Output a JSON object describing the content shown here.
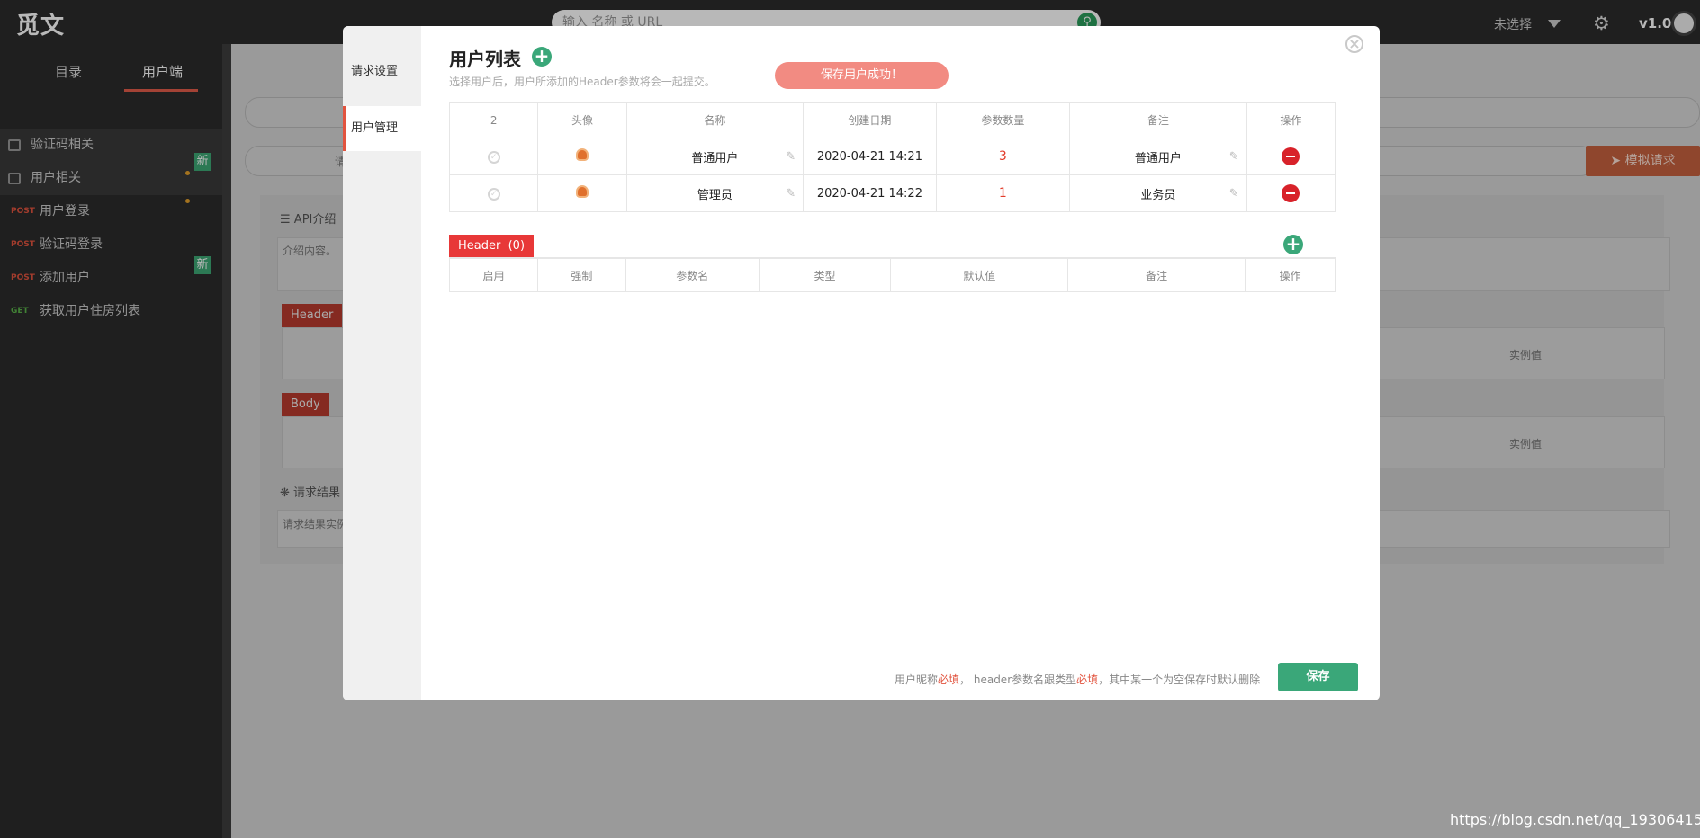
{
  "app": {
    "logo": "觅文",
    "search_placeholder": "输入 名称 或 URL",
    "env_select": "未选择",
    "version": "v1.0"
  },
  "sidebar": {
    "tabs": [
      {
        "label": "目录"
      },
      {
        "label": "用户端"
      }
    ],
    "groups": [
      {
        "label": "验证码相关"
      },
      {
        "label": "用户相关",
        "badge": "新"
      }
    ],
    "apis": [
      {
        "method": "POST",
        "label": "用户登录"
      },
      {
        "method": "POST",
        "label": "验证码登录"
      },
      {
        "method": "POST",
        "label": "添加用户",
        "badge": "新"
      },
      {
        "method": "GET",
        "label": "获取用户住房列表"
      }
    ]
  },
  "background": {
    "send_button": "模拟请求",
    "api_intro": "API介绍",
    "intro_placeholder": "介绍内容。",
    "header_tag": "Header",
    "body_tag": "Body",
    "example_value": "实例值",
    "result_label": "请求结果",
    "result_placeholder": "请求结果实例",
    "url_prefix": "请"
  },
  "modal": {
    "nav": [
      {
        "label": "请求设置"
      },
      {
        "label": "用户管理"
      }
    ],
    "title": "用户列表",
    "subtitle": "选择用户后，用户所添加的Header参数将会一起提交。",
    "toast": "保存用户成功！",
    "users_table": {
      "count": "2",
      "columns": [
        "头像",
        "名称",
        "创建日期",
        "参数数量",
        "备注",
        "操作"
      ],
      "rows": [
        {
          "name": "普通用户",
          "created": "2020-04-21 14:21",
          "param_count": "3",
          "note": "普通用户"
        },
        {
          "name": "管理员",
          "created": "2020-04-21 14:22",
          "param_count": "1",
          "note": "业务员"
        }
      ]
    },
    "header_section": {
      "label": "Header",
      "count": "(0)",
      "columns": [
        "启用",
        "强制",
        "参数名",
        "类型",
        "默认值",
        "备注",
        "操作"
      ]
    },
    "footer": {
      "note_a": "用户昵称",
      "required_1": "必填",
      "note_b": "， header参数名跟类型",
      "required_2": "必填",
      "note_c": "，其中某一个为空保存时默认删除",
      "save": "保存"
    }
  },
  "watermark": "https://blog.csdn.net/qq_19306415",
  "colors": {
    "accent_green": "#3aa779",
    "danger_red": "#d8222a",
    "header_tag_red": "#e83838",
    "toast_pink": "#f28b82"
  }
}
